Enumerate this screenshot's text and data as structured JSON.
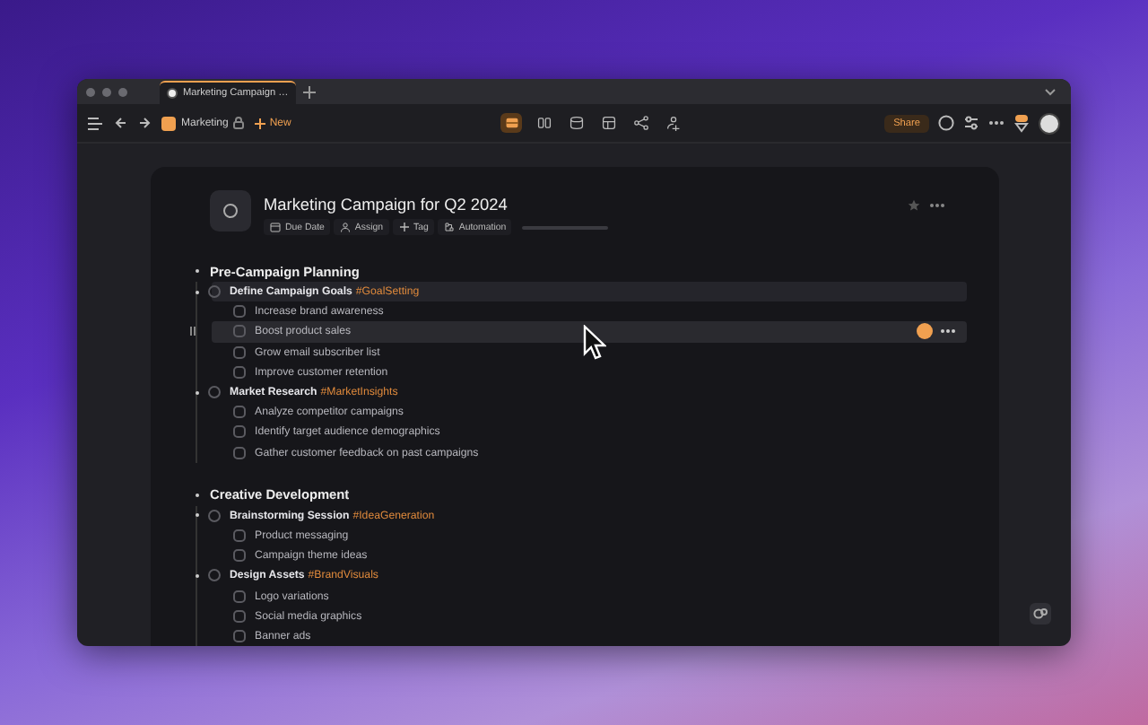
{
  "window": {
    "tab": {
      "title": "Marketing Campaign …",
      "selected": true
    }
  },
  "toolbar": {
    "workspace": "Marketing",
    "new_label": "New",
    "views": [
      {
        "kind": "board",
        "selected": true
      },
      {
        "kind": "split",
        "selected": false
      },
      {
        "kind": "database",
        "selected": false
      },
      {
        "kind": "cube",
        "selected": false
      },
      {
        "kind": "share",
        "selected": false
      },
      {
        "kind": "people",
        "selected": false
      }
    ],
    "share_label": "Share"
  },
  "document": {
    "title": "Marketing Campaign for Q2 2024",
    "actions": [
      {
        "kind": "calendar",
        "label": "Due Date"
      },
      {
        "kind": "person",
        "label": "Assign"
      },
      {
        "kind": "plus",
        "label": "Tag"
      },
      {
        "kind": "automation",
        "label": "Automation"
      }
    ],
    "progress": {
      "level": 0
    },
    "sections": [
      {
        "title": "Pre-Campaign Planning",
        "children": [
          {
            "title": "Define Campaign Goals",
            "tag": "#GoalSetting",
            "checked": false,
            "hovered": true,
            "children": [
              {
                "title": "Increase brand awareness",
                "checked": false,
                "hovered": false
              },
              {
                "title": "Boost product sales",
                "checked": false,
                "hovered": true
              },
              {
                "title": "Grow email subscriber list",
                "checked": false,
                "hovered": false
              },
              {
                "title": "Improve customer retention",
                "checked": false,
                "hovered": false
              }
            ]
          },
          {
            "title": "Market Research",
            "tag": "#MarketInsights",
            "checked": false,
            "hovered": false,
            "children": [
              {
                "title": "Analyze competitor campaigns",
                "checked": false,
                "hovered": false
              },
              {
                "title": "Identify target audience demographics",
                "checked": false,
                "hovered": false
              },
              {
                "title": "Gather customer feedback on past campaigns",
                "checked": false,
                "hovered": false
              }
            ]
          }
        ]
      },
      {
        "title": "Creative Development",
        "children": [
          {
            "title": "Brainstorming Session",
            "tag": "#IdeaGeneration",
            "checked": false,
            "hovered": false,
            "children": [
              {
                "title": "Product messaging",
                "checked": false,
                "hovered": false
              },
              {
                "title": "Campaign theme ideas",
                "checked": false,
                "hovered": false
              }
            ]
          },
          {
            "title": "Design Assets",
            "tag": "#BrandVisuals",
            "checked": false,
            "hovered": false,
            "children": [
              {
                "title": "Logo variations",
                "checked": false,
                "hovered": false
              },
              {
                "title": "Social media graphics",
                "checked": false,
                "hovered": false
              },
              {
                "title": "Banner ads",
                "checked": false,
                "hovered": false
              }
            ]
          }
        ]
      }
    ]
  }
}
